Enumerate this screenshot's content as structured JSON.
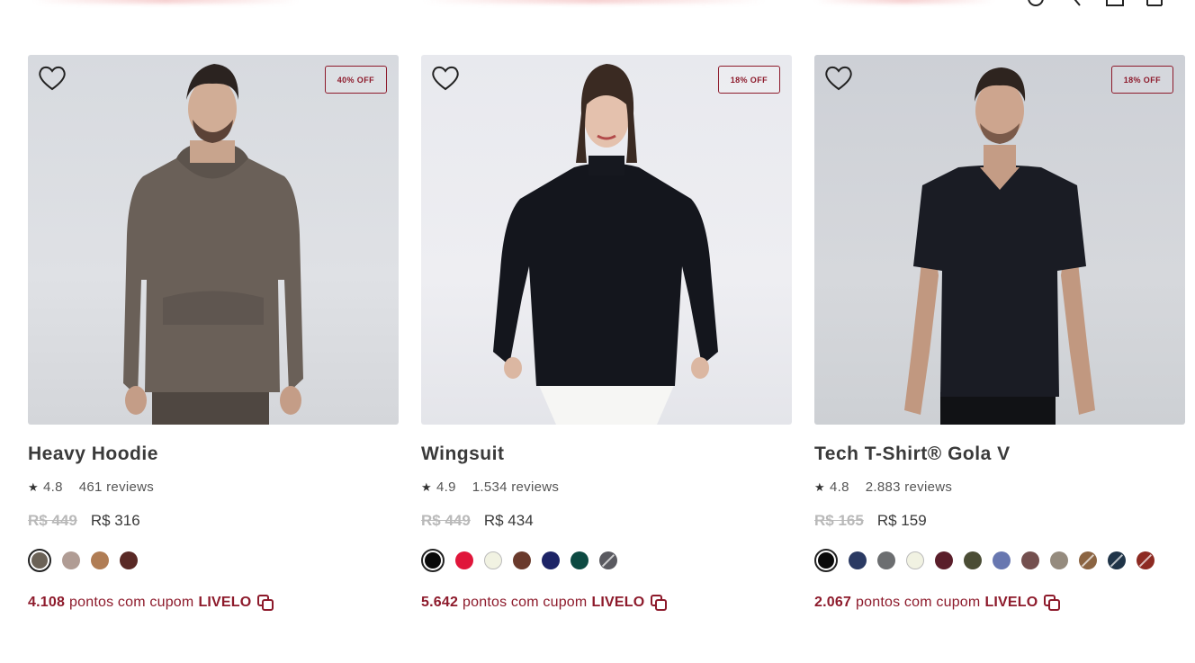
{
  "header": {
    "icons": [
      "account-icon",
      "search-icon",
      "bag-icon",
      "cart-icon"
    ]
  },
  "colors": {
    "accent": "#8d1a2b",
    "text": "#3a3a3a",
    "old_price": "#b9b9b9"
  },
  "products": [
    {
      "name": "Heavy Hoodie",
      "discount": "40% OFF",
      "rating": "4.8",
      "reviews": "461 reviews",
      "old_price": "R$ 449",
      "price": "R$ 316",
      "points": "4.108",
      "points_text": "pontos com cupom",
      "coupon": "LIVELO",
      "swatches": [
        "#6b6257",
        "#b09c94",
        "#b07d55",
        "#5a2a26"
      ]
    },
    {
      "name": "Wingsuit",
      "discount": "18% OFF",
      "rating": "4.9",
      "reviews": "1.534 reviews",
      "old_price": "R$ 449",
      "price": "R$ 434",
      "points": "5.642",
      "points_text": "pontos com cupom",
      "coupon": "LIVELO",
      "swatches": [
        "#0a0a0a",
        "#e0163a",
        "#f1f2e2",
        "#6a3a2c",
        "#1d2466",
        "#0d4a42",
        "#5a5a60"
      ]
    },
    {
      "name": "Tech T-Shirt® Gola V",
      "discount": "18% OFF",
      "rating": "4.8",
      "reviews": "2.883 reviews",
      "old_price": "R$ 165",
      "price": "R$ 159",
      "points": "2.067",
      "points_text": "pontos com cupom",
      "coupon": "LIVELO",
      "swatches": [
        "#0a0a0a",
        "#2b3a63",
        "#6c6e70",
        "#f1f2e2",
        "#5a1e2a",
        "#4b4d35",
        "#6877b0",
        "#74504f",
        "#958b7e",
        "#8b6442",
        "#1f3448",
        "#8d2a22"
      ]
    }
  ]
}
